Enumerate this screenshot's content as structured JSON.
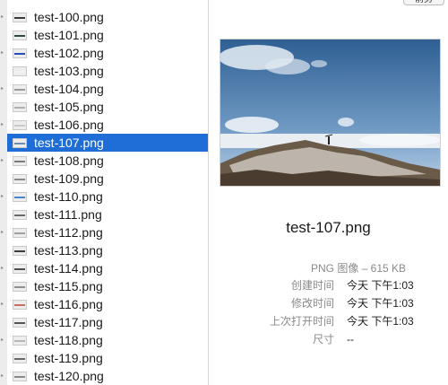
{
  "files": [
    {
      "name": "test-100.png",
      "icon": "image-thumbnail-icon",
      "accent": "#3a3a3a"
    },
    {
      "name": "test-101.png",
      "icon": "image-thumbnail-icon",
      "accent": "#2d4a3a"
    },
    {
      "name": "test-102.png",
      "icon": "image-thumbnail-icon",
      "accent": "#2b4fb8"
    },
    {
      "name": "test-103.png",
      "icon": "image-thumbnail-icon",
      "accent": "#f2f2f2"
    },
    {
      "name": "test-104.png",
      "icon": "image-thumbnail-icon",
      "accent": "#9a9a9a"
    },
    {
      "name": "test-105.png",
      "icon": "image-thumbnail-icon",
      "accent": "#b0b0b0"
    },
    {
      "name": "test-106.png",
      "icon": "image-thumbnail-icon",
      "accent": "#c9c9c9"
    },
    {
      "name": "test-107.png",
      "icon": "image-thumbnail-icon",
      "accent": "#6f8fb0"
    },
    {
      "name": "test-108.png",
      "icon": "image-thumbnail-icon",
      "accent": "#7a7a7a"
    },
    {
      "name": "test-109.png",
      "icon": "image-thumbnail-icon",
      "accent": "#8a8a8a"
    },
    {
      "name": "test-110.png",
      "icon": "image-thumbnail-icon",
      "accent": "#4a86c8"
    },
    {
      "name": "test-111.png",
      "icon": "image-thumbnail-icon",
      "accent": "#6a6a6a"
    },
    {
      "name": "test-112.png",
      "icon": "image-thumbnail-icon",
      "accent": "#a0a0a0"
    },
    {
      "name": "test-113.png",
      "icon": "image-thumbnail-icon",
      "accent": "#3c3c3c"
    },
    {
      "name": "test-114.png",
      "icon": "image-thumbnail-icon",
      "accent": "#505050"
    },
    {
      "name": "test-115.png",
      "icon": "image-thumbnail-icon",
      "accent": "#8f8f8f"
    },
    {
      "name": "test-116.png",
      "icon": "image-thumbnail-icon",
      "accent": "#c07060"
    },
    {
      "name": "test-117.png",
      "icon": "image-thumbnail-icon",
      "accent": "#555555"
    },
    {
      "name": "test-118.png",
      "icon": "image-thumbnail-icon",
      "accent": "#b8b8b8"
    },
    {
      "name": "test-119.png",
      "icon": "image-thumbnail-icon",
      "accent": "#6a6a6a"
    },
    {
      "name": "test-120.png",
      "icon": "image-thumbnail-icon",
      "accent": "#8a8a8a"
    }
  ],
  "selected_index": 7,
  "colors": {
    "selection": "#1f6dd6"
  },
  "preview": {
    "top_button_label": "前剪",
    "filename": "test-107.png",
    "kind": "PNG 图像 – 615 KB",
    "info": [
      {
        "label": "创建时间",
        "value": "今天 下午1:03"
      },
      {
        "label": "修改时间",
        "value": "今天 下午1:03"
      },
      {
        "label": "上次打开时间",
        "value": "今天 下午1:03"
      },
      {
        "label": "尺寸",
        "value": "--"
      }
    ]
  }
}
